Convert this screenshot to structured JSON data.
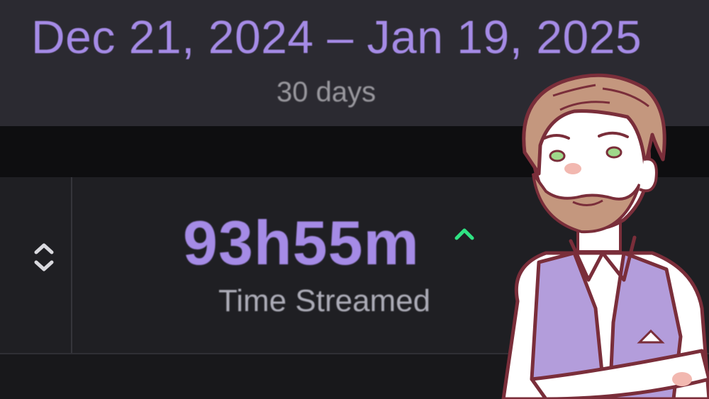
{
  "date_header": {
    "range": "Dec 21, 2024 – Jan 19, 2025",
    "days": "30 days"
  },
  "stat": {
    "value": "93h55m",
    "label": "Time Streamed",
    "trend": "up"
  },
  "icons": {
    "sort": "sort-up-down-icon",
    "trend": "trend-up-icon"
  },
  "colors": {
    "accent": "#a58be6",
    "trend_up": "#2fe383",
    "background": "#18181b",
    "header_bg": "#2b2a31"
  }
}
